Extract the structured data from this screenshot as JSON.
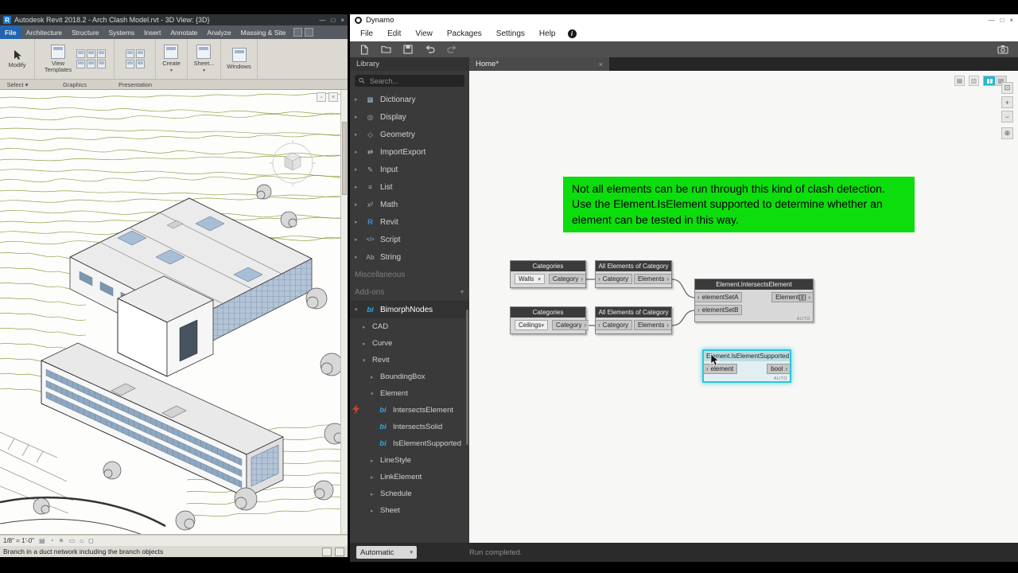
{
  "glyphs": {
    "collapsed": "▸",
    "expanded": "▾",
    "dropdown": "▾",
    "close": "×",
    "minimize": "—",
    "maximize": "□",
    "plus": "+",
    "port": "›",
    "info": "i",
    "revit_logo": "R",
    "bi": "bi"
  },
  "revit": {
    "title": "Autodesk Revit 2018.2 - Arch Clash Model.rvt - 3D View: {3D}",
    "tabs": [
      {
        "label": "File"
      },
      {
        "label": "Architecture"
      },
      {
        "label": "Structure"
      },
      {
        "label": "Systems"
      },
      {
        "label": "Insert"
      },
      {
        "label": "Annotate"
      },
      {
        "label": "Analyze"
      },
      {
        "label": "Massing & Site"
      }
    ],
    "ribbon": {
      "modify": "Modify",
      "select": "Select ▾",
      "view_templates": "View Templates",
      "graphics": "Graphics",
      "presentation": "Presentation",
      "create": "Create",
      "sheet": "Sheet...",
      "windows": "Windows"
    },
    "view_bar": {
      "scale": "1/8\" = 1'-0\"",
      "icons": [
        "▤",
        "◔",
        "☀",
        "▭",
        "⌂",
        "◻"
      ]
    },
    "status": "Branch in a duct network including the branch objects",
    "colors": {
      "file_tab": "#2364ae"
    }
  },
  "dynamo": {
    "title": "Dynamo",
    "menus": [
      {
        "label": "File"
      },
      {
        "label": "Edit"
      },
      {
        "label": "View"
      },
      {
        "label": "Packages"
      },
      {
        "label": "Settings"
      },
      {
        "label": "Help"
      }
    ],
    "tab": "Home*",
    "library": {
      "header": "Library",
      "search_placeholder": "Search...",
      "sections": [
        {
          "label": "Dictionary",
          "glyph": "▦"
        },
        {
          "label": "Display",
          "glyph": "◎"
        },
        {
          "label": "Geometry",
          "glyph": "◇"
        },
        {
          "label": "ImportExport",
          "glyph": "⇄"
        },
        {
          "label": "Input",
          "glyph": "✎"
        },
        {
          "label": "List",
          "glyph": "≡"
        },
        {
          "label": "Math",
          "glyph": "x²"
        },
        {
          "label": "Revit",
          "glyph": "R"
        },
        {
          "label": "Script",
          "glyph": "</>"
        },
        {
          "label": "String",
          "glyph": "Ab"
        }
      ],
      "miscellaneous": "Miscellaneous",
      "addons": "Add-ons",
      "package": "BimorphNodes",
      "tree": {
        "cad": "CAD",
        "curve": "Curve",
        "revit": "Revit",
        "boundingbox": "BoundingBox",
        "element": "Element",
        "leaves": [
          {
            "label": "IntersectsElement"
          },
          {
            "label": "IntersectsSolid"
          },
          {
            "label": "IsElementSupported"
          }
        ],
        "siblings": [
          {
            "label": "LineStyle"
          },
          {
            "label": "LinkElement"
          },
          {
            "label": "Schedule"
          },
          {
            "label": "Sheet"
          }
        ]
      }
    },
    "run_bar": {
      "mode": "Automatic",
      "status": "Run completed."
    }
  },
  "canvas": {
    "note": "Not all elements can be run through this kind of clash detection. Use the Element.IsElement supported to determine whether an element can be tested in this way.",
    "nodes": {
      "categories_walls": {
        "title": "Categories",
        "value": "Walls",
        "out": "Category"
      },
      "all_elements_a": {
        "title": "All Elements of Category",
        "in": "Category",
        "out": "Elements"
      },
      "categories_ceilings": {
        "title": "Categories",
        "value": "Ceilings",
        "out": "Category"
      },
      "all_elements_b": {
        "title": "All Elements of Category",
        "in": "Category",
        "out": "Elements"
      },
      "intersects_element": {
        "title": "Element.IntersectsElement",
        "in_a": "elementSetA",
        "in_b": "elementSetB",
        "out": "Element[][]",
        "lacing": "AUTO"
      },
      "is_element_supported": {
        "title": "Element.IsElementSupported",
        "in": "element",
        "out": "bool",
        "lacing": "AUTO"
      }
    },
    "colors": {
      "note_bg": "#0ddd0d",
      "selection": "#2fc5d8"
    }
  }
}
